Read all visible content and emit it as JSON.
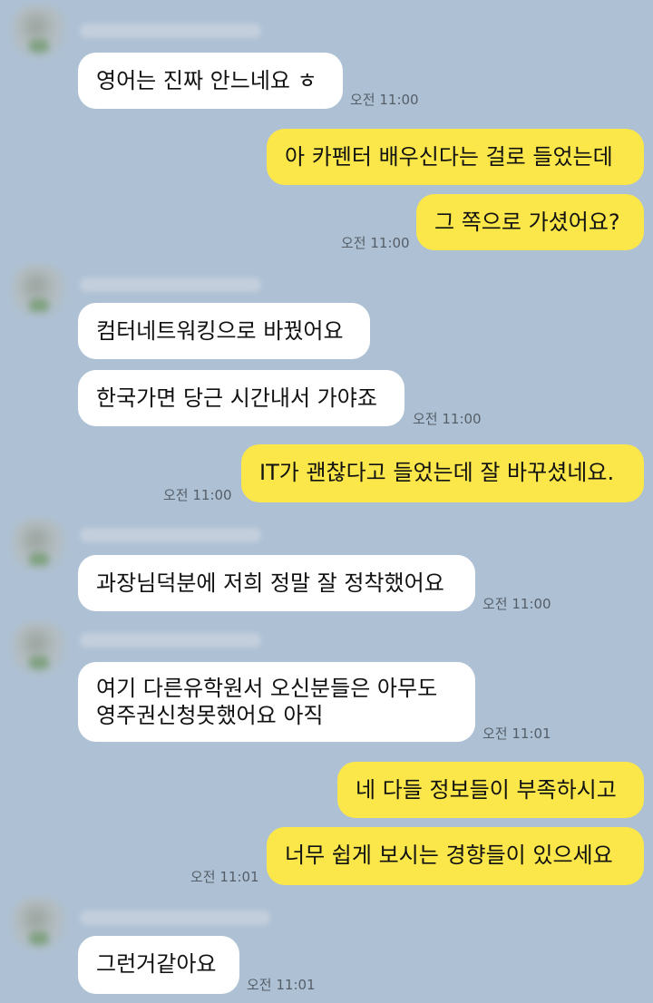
{
  "messages": [
    {
      "dir": "in",
      "text": "영어는 진짜 안느네요 ㅎ",
      "time": "오전 11:00"
    },
    {
      "dir": "out",
      "text": "아 카펜터 배우신다는 걸로 들었는데",
      "time": ""
    },
    {
      "dir": "out",
      "text": "그 쪽으로 가셨어요?",
      "time": "오전 11:00"
    },
    {
      "dir": "in",
      "text": "컴터네트워킹으로 바꿨어요",
      "time": ""
    },
    {
      "dir": "in",
      "text": "한국가면 당근 시간내서 가야죠",
      "time": "오전 11:00"
    },
    {
      "dir": "out",
      "text": "IT가 괜찮다고 들었는데 잘 바꾸셨네요.",
      "time": "오전 11:00"
    },
    {
      "dir": "in",
      "text": "과장님덕분에 저희 정말 잘 정착했어요",
      "time": "오전 11:00"
    },
    {
      "dir": "in",
      "text": "여기 다른유학원서 오신분들은 아무도",
      "text2": "영주권신청못했어요 아직",
      "time": "오전 11:01"
    },
    {
      "dir": "out",
      "text": "네 다들 정보들이 부족하시고",
      "time": ""
    },
    {
      "dir": "out",
      "text": "너무 쉽게 보시는 경향들이 있으세요",
      "time": "오전 11:01"
    },
    {
      "dir": "in",
      "text": "그런거같아요",
      "time": "오전 11:01"
    }
  ]
}
